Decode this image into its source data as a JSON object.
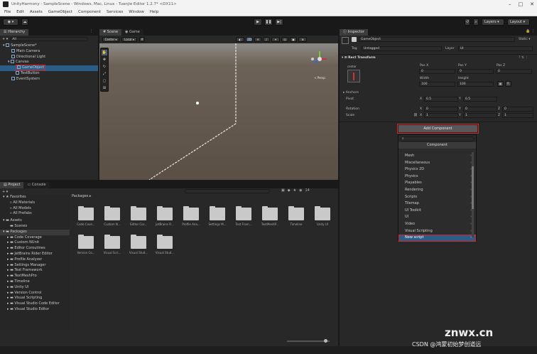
{
  "window": {
    "title": "UnityHarmony - SampleScene - Windows, Mac, Linux - Tuanjie Editor 1.2.7* <DX11>"
  },
  "menu": [
    "File",
    "Edit",
    "Assets",
    "GameObject",
    "Component",
    "Services",
    "Window",
    "Help"
  ],
  "toolbar": {
    "layers": "Layers",
    "layout": "Layout"
  },
  "hierarchy": {
    "tab": "Hierarchy",
    "search": "All",
    "items": [
      {
        "label": "SampleScene*"
      },
      {
        "label": "Main Camera"
      },
      {
        "label": "Directional Light"
      },
      {
        "label": "Canvas"
      },
      {
        "label": "GameObject"
      },
      {
        "label": "TestButton"
      },
      {
        "label": "EventSystem"
      }
    ]
  },
  "scene": {
    "tabs": [
      "Scene",
      "Game"
    ],
    "pivot": "Center",
    "space": "Local",
    "view_2d": "2D",
    "persp": "< Persp"
  },
  "project": {
    "tabs": [
      "Project",
      "Console"
    ],
    "breadcrumb": "Packages",
    "tree": [
      {
        "label": "Favorites"
      },
      {
        "label": "All Materials"
      },
      {
        "label": "All Models"
      },
      {
        "label": "All Prefabs"
      },
      {
        "label": "Assets"
      },
      {
        "label": "Scenes"
      },
      {
        "label": "Packages"
      },
      {
        "label": "Code Coverage"
      },
      {
        "label": "Custom NUnit"
      },
      {
        "label": "Editor Coroutines"
      },
      {
        "label": "JetBrains Rider Editor"
      },
      {
        "label": "Profile Analyzer"
      },
      {
        "label": "Settings Manager"
      },
      {
        "label": "Test Framework"
      },
      {
        "label": "TextMeshPro"
      },
      {
        "label": "Timeline"
      },
      {
        "label": "Unity UI"
      },
      {
        "label": "Version Control"
      },
      {
        "label": "Visual Scripting"
      },
      {
        "label": "Visual Studio Code Editor"
      },
      {
        "label": "Visual Studio Editor"
      }
    ],
    "folders": [
      {
        "name": "Code Cove..."
      },
      {
        "name": "Custom N..."
      },
      {
        "name": "Editor Cor..."
      },
      {
        "name": "JetBrains R..."
      },
      {
        "name": "Profile Ana..."
      },
      {
        "name": "Settings M..."
      },
      {
        "name": "Test Fram..."
      },
      {
        "name": "TextMeshP..."
      },
      {
        "name": "Timeline"
      },
      {
        "name": "Unity UI"
      },
      {
        "name": "Version Co..."
      },
      {
        "name": "Visual Scri..."
      },
      {
        "name": "Visual Stud..."
      },
      {
        "name": "Visual Stud..."
      }
    ],
    "count": "14"
  },
  "inspector": {
    "tab": "Inspector",
    "object_name": "GameObject",
    "static": "Static",
    "tag_label": "Tag",
    "tag": "Untagged",
    "layer_label": "Layer",
    "layer": "UI",
    "rect_transform": "Rect Transform",
    "anchor_label": "center",
    "pos_x_label": "Pos X",
    "pos_y_label": "Pos Y",
    "pos_z_label": "Pos Z",
    "pos_x": "0",
    "pos_y": "0",
    "pos_z": "0",
    "width_label": "Width",
    "height_label": "Height",
    "width": "100",
    "height": "100",
    "anchors": "Anchors",
    "pivot_label": "Pivot",
    "pivot_x": "0.5",
    "pivot_y": "0.5",
    "rotation_label": "Rotation",
    "rot_x": "0",
    "rot_y": "0",
    "rot_z": "0",
    "scale_label": "Scale",
    "scale_x": "1",
    "scale_y": "1",
    "scale_z": "1",
    "axis_x": "X",
    "axis_y": "Y",
    "axis_z": "Z",
    "R": "R",
    "add_component": "Add Component",
    "component_header": "Component",
    "components": [
      "Mesh",
      "Miscellaneous",
      "Physics 2D",
      "Physics",
      "Playables",
      "Rendering",
      "Scripts",
      "Tilemap",
      "UI Toolkit",
      "UI",
      "Video",
      "Visual Scripting"
    ],
    "new_script": "New script"
  },
  "watermark": {
    "site": "znwx.cn",
    "csdn": "CSDN @鸿蒙初始梦创道远"
  },
  "colors": {
    "accent": "#2c5d87",
    "highlight_red": "#d22222",
    "scene_ground": "#5a4f44"
  }
}
